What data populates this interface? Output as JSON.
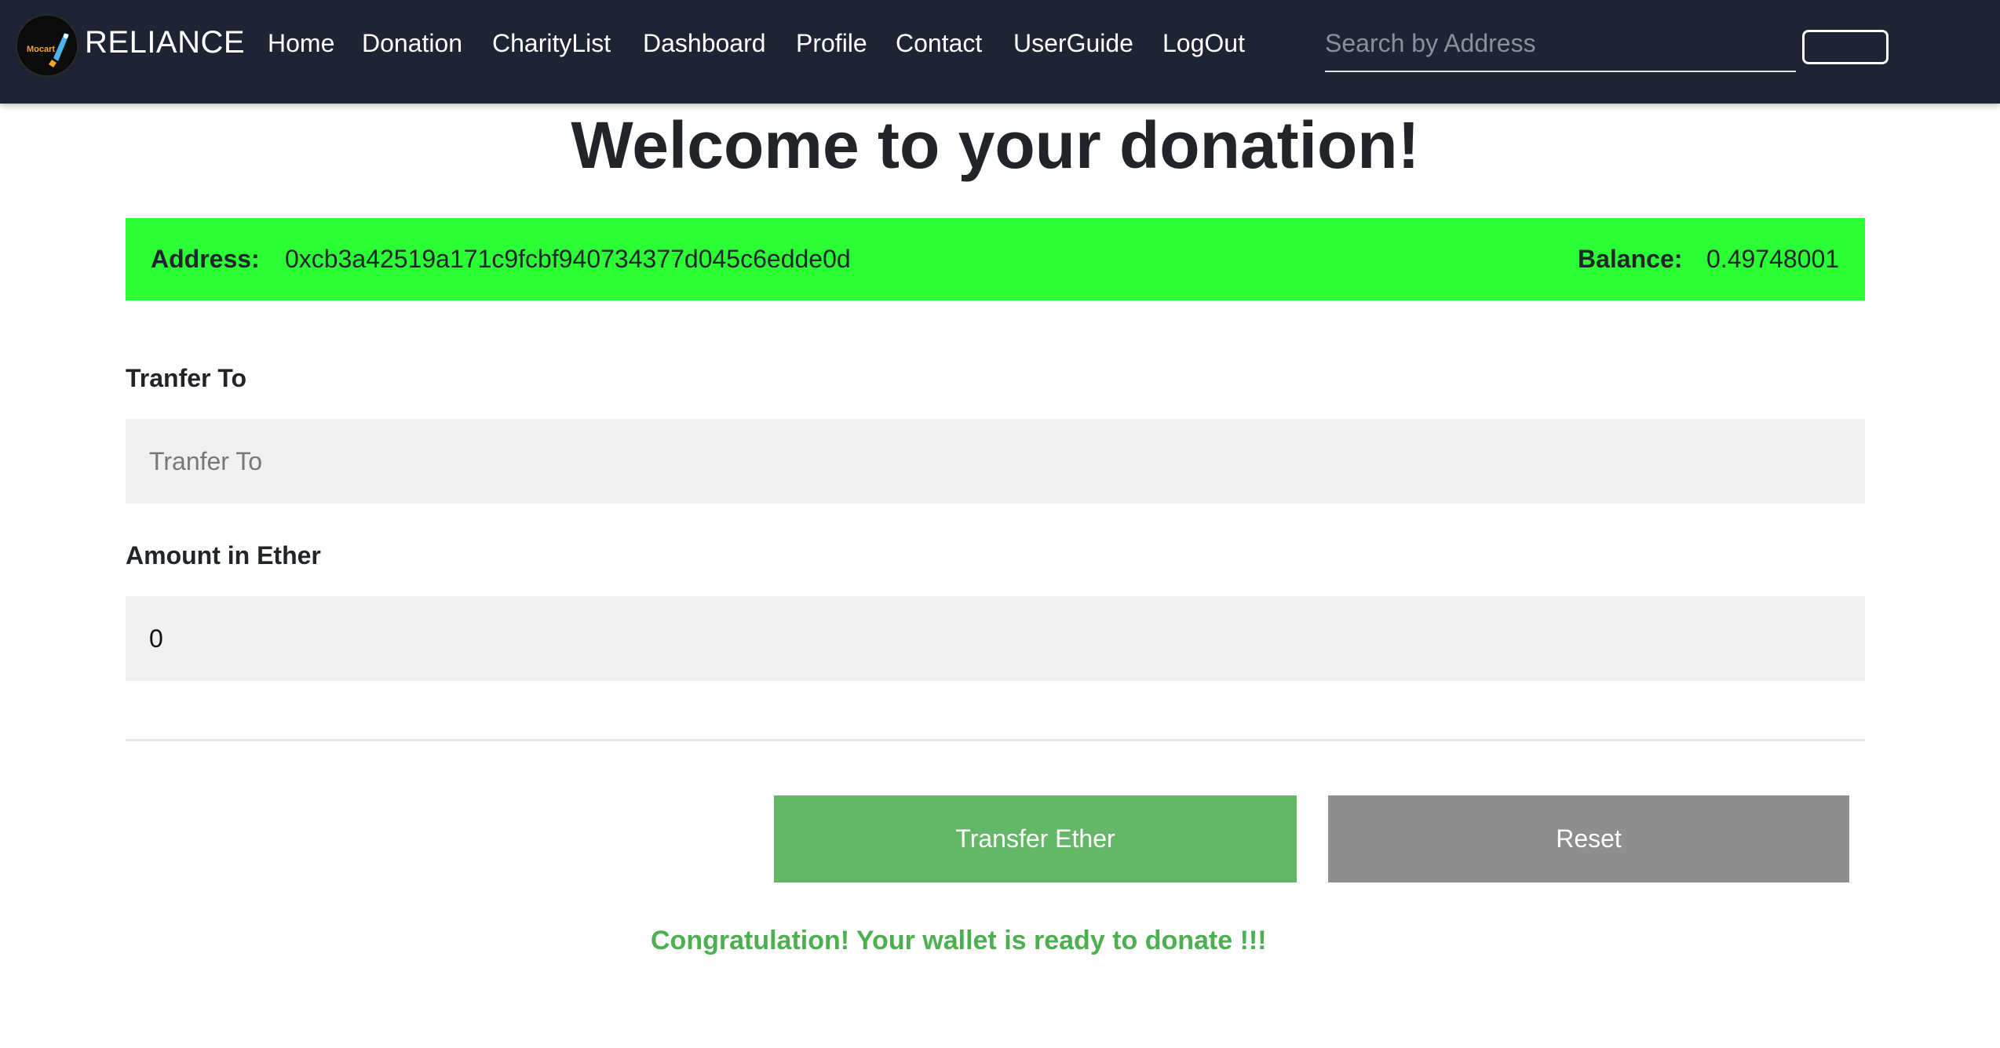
{
  "navbar": {
    "brand": "RELIANCE",
    "logo_text": "Mocart",
    "items": [
      {
        "label": "Home"
      },
      {
        "label": "Donation"
      },
      {
        "label": "CharityList"
      },
      {
        "label": "Dashboard"
      },
      {
        "label": "Profile"
      },
      {
        "label": "Contact"
      },
      {
        "label": "UserGuide"
      },
      {
        "label": "LogOut"
      }
    ],
    "search": {
      "placeholder": "Search by Address",
      "value": ""
    },
    "search_button_label": ""
  },
  "main": {
    "title": "Welcome to your donation!",
    "info": {
      "address_label": "Address:",
      "address_value": "0xcb3a42519a171c9fcbf940734377d045c6edde0d",
      "balance_label": "Balance:",
      "balance_value": "0.49748001",
      "bar_color": "#2bff35"
    },
    "transfer_to": {
      "label": "Tranfer To",
      "placeholder": "Tranfer To",
      "value": ""
    },
    "amount": {
      "label": "Amount in Ether",
      "value": "0"
    },
    "buttons": {
      "transfer": "Transfer Ether",
      "reset": "Reset"
    },
    "status_message": "Congratulation! Your wallet is ready to donate !!!"
  },
  "colors": {
    "navbar": "#1e2433",
    "transfer_button": "#64b766",
    "reset_button": "#8e8e8e",
    "status_text": "#4caf50"
  }
}
